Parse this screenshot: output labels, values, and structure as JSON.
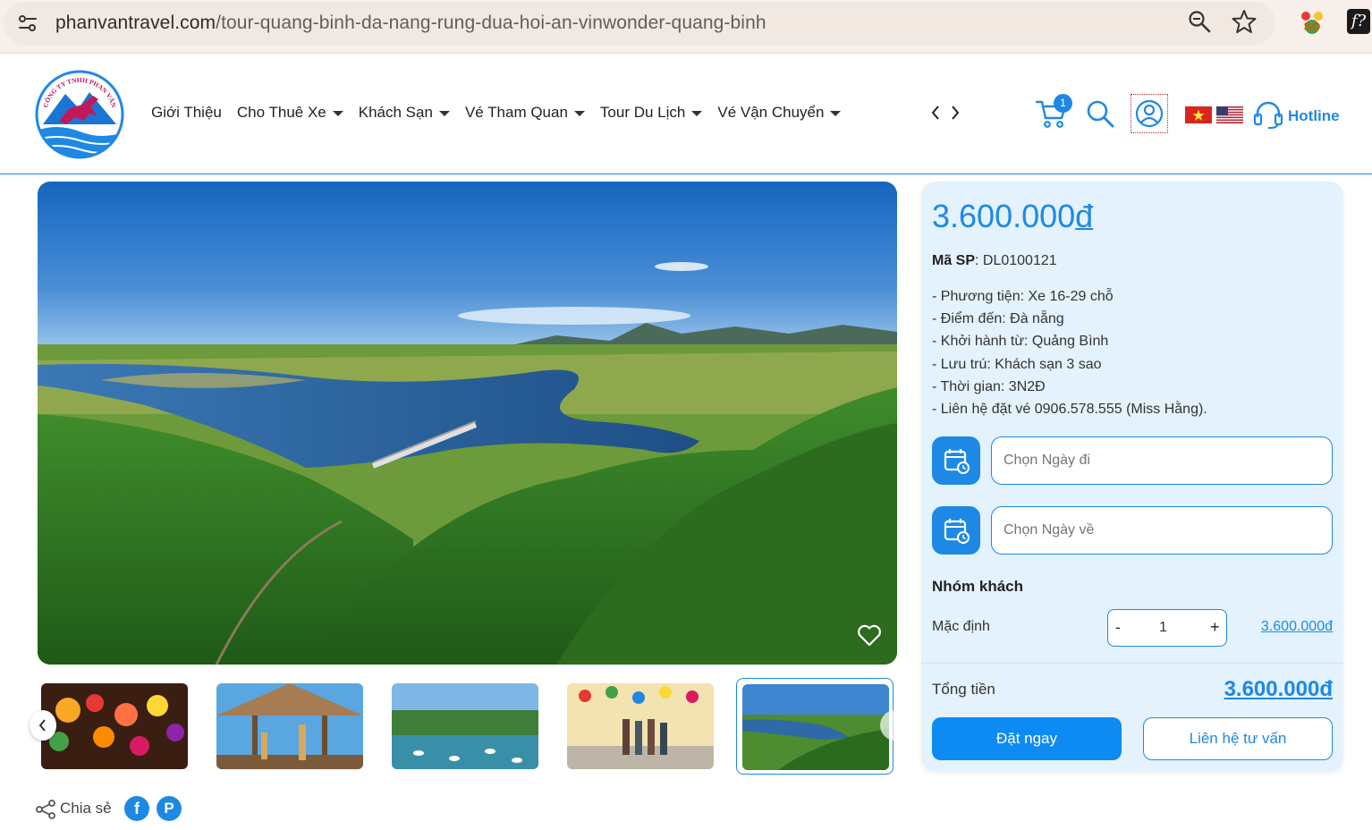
{
  "browser": {
    "url_domain": "phanvantravel.com",
    "url_path": "/tour-quang-binh-da-nang-rung-dua-hoi-an-vinwonder-quang-binh",
    "icons": [
      "tune-icon",
      "zoom-icon",
      "star-icon",
      "extension-so-icon",
      "extension-f-icon"
    ],
    "ext_f_label": "f?"
  },
  "header": {
    "logo_text": "CÔNG TY TNHH PHAN VÂN",
    "nav": [
      {
        "label": "Giới Thiệu",
        "has_dropdown": false
      },
      {
        "label": "Cho Thuê Xe",
        "has_dropdown": true
      },
      {
        "label": "Khách Sạn",
        "has_dropdown": true
      },
      {
        "label": "Vé Tham Quan",
        "has_dropdown": true
      },
      {
        "label": "Tour Du Lịch",
        "has_dropdown": true
      },
      {
        "label": "Vé Vận Chuyển",
        "has_dropdown": true
      }
    ],
    "cart_count": "1",
    "hotline_label": "Hotline",
    "accent_color": "#1e88e5"
  },
  "gallery": {
    "thumbnails": [
      "hoi-an-lanterns",
      "giraffe-hut",
      "lake-park",
      "lantern-street",
      "river-bridge-aerial"
    ],
    "active_index": 4
  },
  "share": {
    "label": "Chia sẻ",
    "fb": "f",
    "pin": "P"
  },
  "booking": {
    "price": "3.600.000",
    "currency": "đ",
    "sku_label": "Mã SP",
    "sku_value": ": DL0100121",
    "features": [
      "- Phương tiện: Xe 16-29 chỗ",
      "- Điểm đến: Đà nẵng",
      "- Khởi hành từ: Quảng Bình",
      "- Lưu trú: Khách sạn 3 sao",
      "- Thời gian: 3N2Đ",
      "- Liên hệ đặt vé 0906.578.555 (Miss Hằng)."
    ],
    "depart_placeholder": "Chọn Ngày đi",
    "return_placeholder": "Chọn Ngày về",
    "group_title": "Nhóm khách",
    "default_label": "Mặc định",
    "minus": "-",
    "plus": "+",
    "quantity": "1",
    "line_price": "3.600.000đ",
    "total_label": "Tổng tiền",
    "total_value": "3.600.000đ",
    "book_button": "Đặt ngay",
    "contact_button": "Liên hệ tư vấn"
  }
}
